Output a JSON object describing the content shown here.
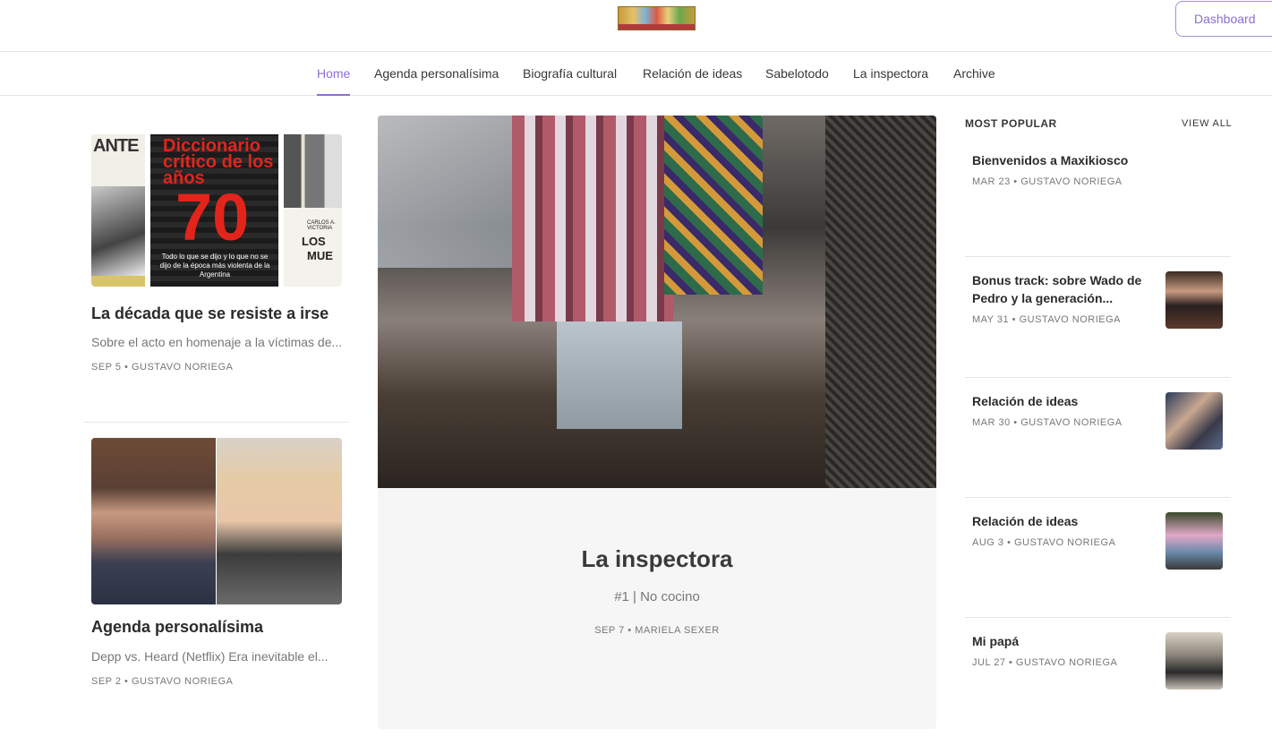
{
  "header": {
    "dashboard_label": "Dashboard"
  },
  "nav": {
    "items": [
      {
        "label": "Home",
        "active": true
      },
      {
        "label": "Agenda personalísima",
        "active": false
      },
      {
        "label": "Biografía cultural",
        "active": false
      },
      {
        "label": "Relación de ideas",
        "active": false
      },
      {
        "label": "Sabelotodo",
        "active": false
      },
      {
        "label": "La inspectora",
        "active": false
      },
      {
        "label": "Archive",
        "active": false
      }
    ]
  },
  "left": {
    "posts": [
      {
        "title": "La década que se resiste a irse",
        "subtitle": "Sobre el acto en homenaje a la víctimas de...",
        "meta": "SEP 5 • GUSTAVO NORIEGA",
        "cover": {
          "book1_lettering": "ANTE",
          "book2_title": "Diccionario crítico de los años",
          "book2_number": "70",
          "book2_tagline": "Todo lo que se dijo y lo que no se dijo de la época más violenta de la Argentina",
          "book3_authors": "CARLOS A. VICTORIA",
          "book3_line1": "LOS",
          "book3_line2": "MUE"
        }
      },
      {
        "title": "Agenda personalísima",
        "subtitle": "Depp vs. Heard (Netflix) Era inevitable el...",
        "meta": "SEP 2 • GUSTAVO NORIEGA"
      }
    ]
  },
  "feature": {
    "title": "La inspectora",
    "subtitle": "#1 | No cocino",
    "meta": "SEP 7 • MARIELA SEXER"
  },
  "popular": {
    "header": "MOST POPULAR",
    "view_all": "VIEW ALL",
    "items": [
      {
        "title": "Bienvenidos a Maxikiosco",
        "meta": "MAR 23 • GUSTAVO NORIEGA",
        "has_thumb": false
      },
      {
        "title": "Bonus track: sobre Wado de Pedro y la generación...",
        "meta": "MAY 31 • GUSTAVO NORIEGA",
        "has_thumb": true
      },
      {
        "title": "Relación de ideas",
        "meta": "MAR 30 • GUSTAVO NORIEGA",
        "has_thumb": true
      },
      {
        "title": "Relación de ideas",
        "meta": "AUG 3 • GUSTAVO NORIEGA",
        "has_thumb": true
      },
      {
        "title": "Mi papá",
        "meta": "JUL 27 • GUSTAVO NORIEGA",
        "has_thumb": true
      }
    ]
  }
}
